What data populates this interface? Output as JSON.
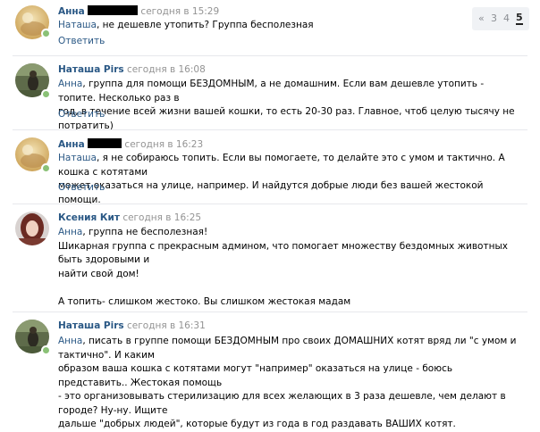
{
  "pager": {
    "prev": "«",
    "pages": [
      "3",
      "4",
      "5"
    ],
    "active": "5"
  },
  "reply_label": "Ответить",
  "comments": [
    {
      "author": "Анна",
      "author_redacted": true,
      "time": "сегодня в 15:29",
      "addressee": "Наташа",
      "lines": [
        "Наташа, не дешевле утопить? Группа бесполезная"
      ]
    },
    {
      "author": "Наташа Pirs",
      "time": "сегодня в 16:08",
      "addressee": "Анна",
      "lines": [
        "Анна, группа для помощи БЕЗДОМНЫМ, а не домашним. Если вам дешевле утопить - топите. Несколько раз в",
        "год, в течение всей жизни вашей кошки, то есть 20-30 раз. Главное, чтоб целую тысячу не потратить)"
      ]
    },
    {
      "author": "Анна",
      "author_redacted": true,
      "time": "сегодня в 16:23",
      "addressee": "Наташа",
      "lines": [
        "Наташа, я не собираюсь топить. Если вы помогаете, то делайте это с умом и тактично. А кошка с котятами",
        "может оказаться на улице, например. И найдутся добрые люди без вашей жестокой помощи."
      ]
    },
    {
      "author": "Ксения Кит",
      "time": "сегодня в 16:25",
      "addressee": "Анна",
      "lines": [
        "Анна, группа не бесполезная!",
        "Шикарная группа с прекрасным админом, что помогает множеству бездомных животных быть здоровыми и",
        "найти свой дом!",
        "",
        "А топить- слишком жестоко. Вы слишком жестокая мадам"
      ]
    },
    {
      "author": "Наташа Pirs",
      "time": "сегодня в 16:31",
      "addressee": "Анна",
      "lines": [
        "Анна, писать в группе помощи БЕЗДОМНЫМ про своих ДОМАШНИХ котят вряд ли \"с умом и тактично\". И каким",
        "образом ваша кошка с котятами могут \"например\" оказаться на улице - боюсь представить.. Жестокая помощь",
        "- это организовывать стерилизацию для всех желающих в 3 раза дешевле, чем делают в городе? Ну-ну. Ищите",
        "дальше \"добрых людей\", которые будут из года в год раздавать ВАШИХ котят."
      ]
    }
  ],
  "colors": {
    "link": "#2a5885",
    "time": "#939393",
    "separator": "#e7e8ec",
    "online": "#8ac176"
  }
}
